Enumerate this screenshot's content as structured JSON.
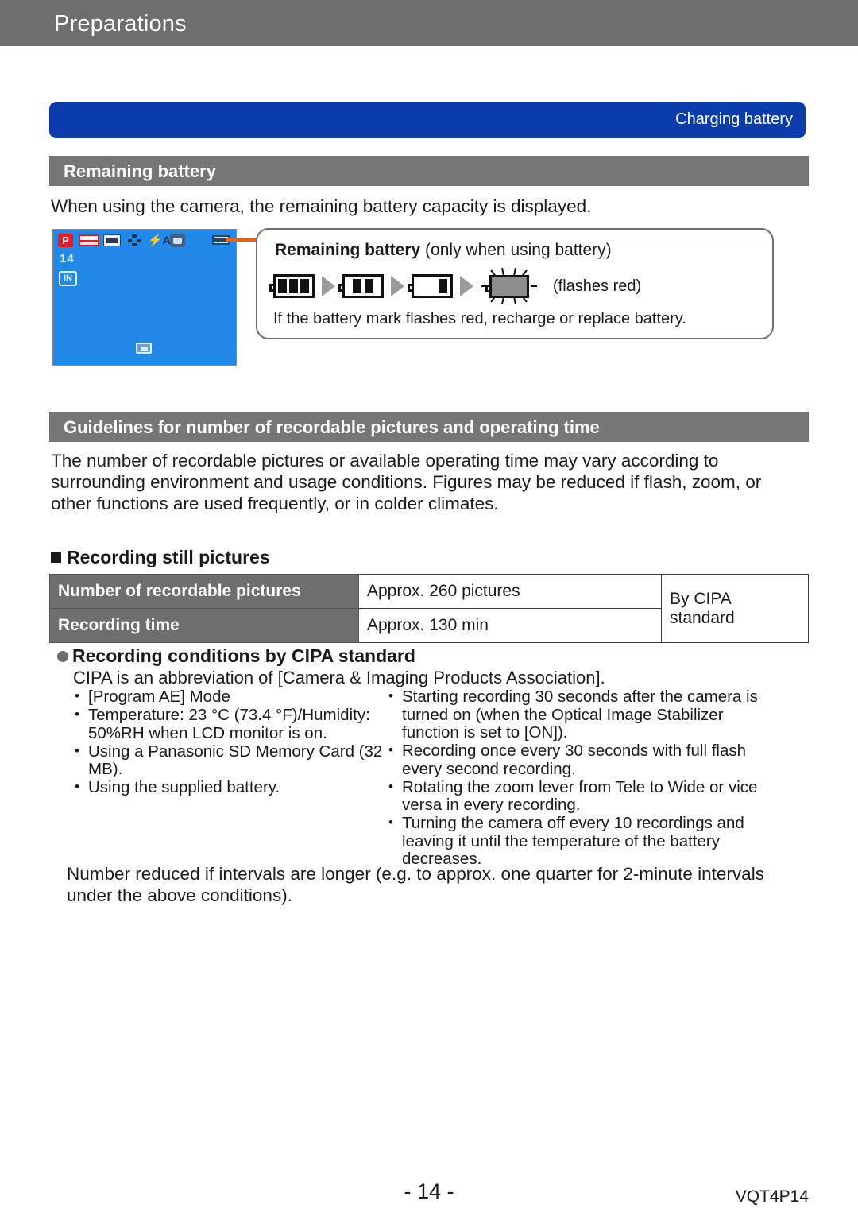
{
  "header": {
    "title": "Preparations"
  },
  "banner": {
    "label": "Charging battery"
  },
  "sections": {
    "remaining_battery": {
      "heading": "Remaining battery",
      "intro": "When using the camera, the remaining battery capacity is displayed.",
      "callout": {
        "title_bold": "Remaining battery",
        "title_rest": " (only when using battery)",
        "flashes_label": "(flashes red)",
        "note": "If the battery mark flashes red, recharge or replace battery."
      },
      "lcd": {
        "mode_label": "P",
        "count_label": "14",
        "memory_label": "IN"
      }
    },
    "guidelines": {
      "heading": "Guidelines for number of recordable pictures and operating time",
      "paragraph": "The number of recordable pictures or available operating time may vary according to surrounding environment and usage conditions. Figures may be reduced if flash, zoom, or other functions are used frequently, or in colder climates.",
      "still_pictures_heading": "Recording still pictures",
      "table": {
        "rows": [
          {
            "label": "Number of recordable pictures",
            "value": "Approx. 260 pictures"
          },
          {
            "label": "Recording time",
            "value": "Approx. 130 min"
          }
        ],
        "standard": "By CIPA standard"
      },
      "cipa": {
        "heading": "Recording conditions by CIPA standard",
        "definition": "CIPA is an abbreviation of [Camera & Imaging Products Association].",
        "bullets_left": [
          "[Program AE] Mode",
          "Temperature: 23 °C (73.4 °F)/Humidity: 50%RH when LCD monitor is on.",
          "Using a Panasonic SD Memory Card (32 MB).",
          "Using the supplied battery."
        ],
        "bullets_right": [
          "Starting recording 30 seconds after the camera is turned on (when the Optical Image Stabilizer function is set to [ON]).",
          "Recording once every 30 seconds with full flash every second recording.",
          "Rotating the zoom lever from Tele to Wide or vice versa in every recording.",
          "Turning the camera off every 10 recordings and leaving it until the temperature of the battery decreases."
        ],
        "closing": "Number reduced if intervals are longer (e.g. to approx. one quarter for 2-minute intervals under the above conditions)."
      }
    }
  },
  "footer": {
    "page_number": "- 14 -",
    "doc_code": "VQT4P14"
  },
  "colors": {
    "header_gray": "#6e6e6e",
    "banner_blue": "#0b3cab",
    "connector_orange": "#ec6016",
    "lcd_blue": "#2389e8"
  }
}
